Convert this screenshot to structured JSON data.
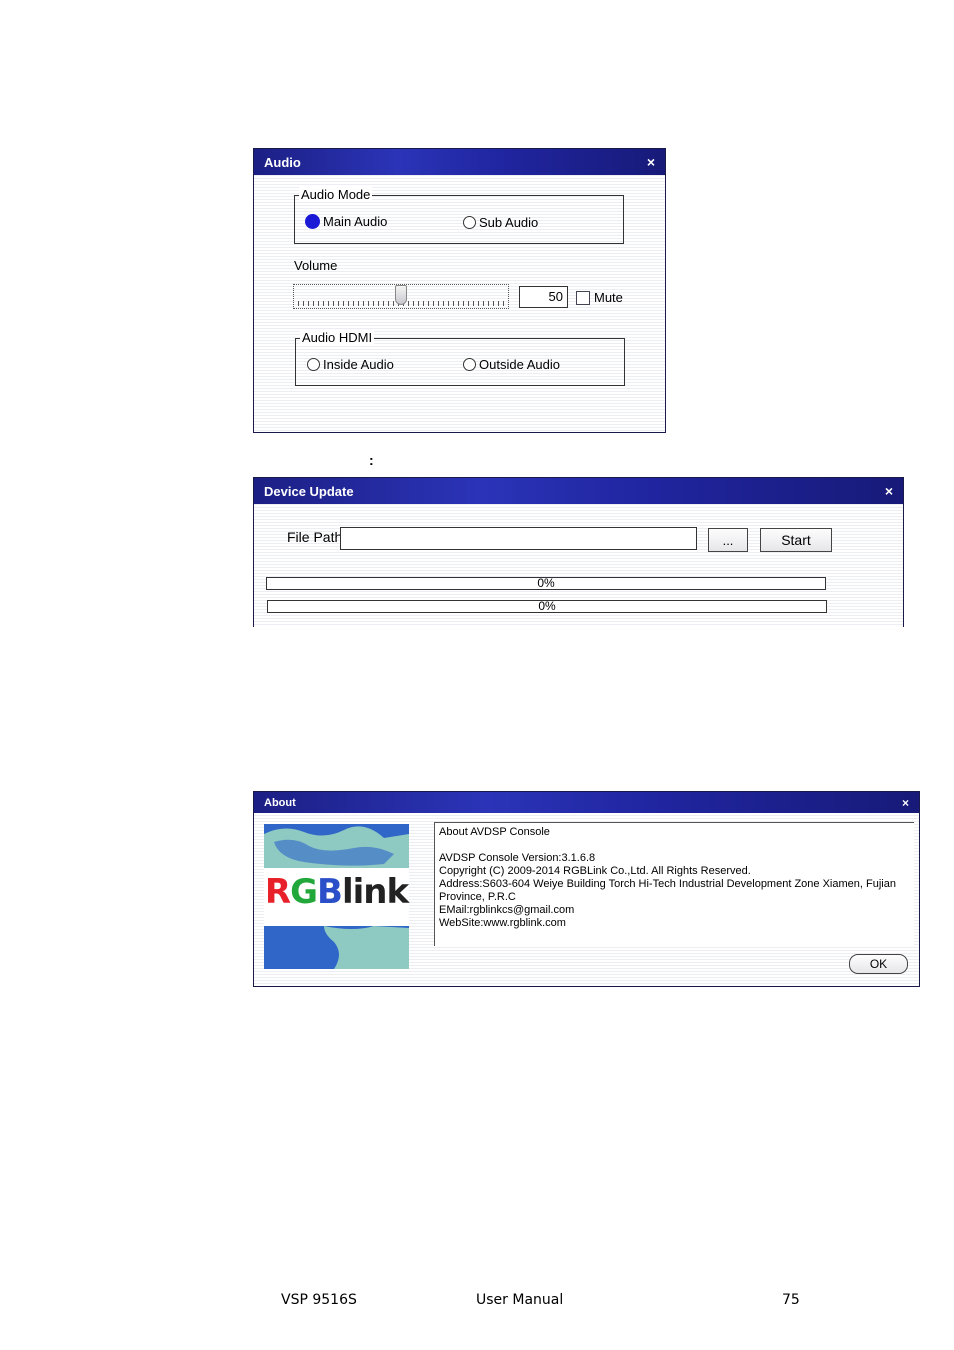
{
  "audio_dialog": {
    "title": "Audio",
    "close": "×",
    "audio_mode": {
      "label": "Audio Mode",
      "options": [
        "Main Audio",
        "Sub Audio"
      ],
      "selected": "Main Audio"
    },
    "volume": {
      "label": "Volume",
      "value": "50",
      "level_percent": 50,
      "mute_label": "Mute",
      "mute_checked": false
    },
    "audio_hdmi": {
      "label": "Audio HDMI",
      "options": [
        "Inside Audio",
        "Outside Audio"
      ],
      "selected": ""
    }
  },
  "separator_text": ":",
  "device_update_dialog": {
    "title": "Device Update",
    "close": "×",
    "file_path_label": "File Path",
    "file_path_value": "",
    "browse_label": "...",
    "start_label": "Start",
    "progress": [
      {
        "text": "0%",
        "percent": 0
      },
      {
        "text": "0%",
        "percent": 0
      }
    ]
  },
  "about_dialog": {
    "title": "About",
    "close": "×",
    "logo_text": "RGBlink",
    "lines": [
      "About AVDSP Console",
      "",
      "AVDSP Console  Version:3.1.6.8",
      "Copyright (C) 2009-2014 RGBLink Co.,Ltd. All Rights Reserved.",
      "Address:S603-604 Weiye Building Torch Hi-Tech Industrial Development Zone Xiamen, Fujian",
      "Province, P.R.C",
      "EMail:rgblinkcs@gmail.com",
      "WebSite:www.rgblink.com"
    ],
    "ok_label": "OK"
  },
  "footer": {
    "product": "VSP 9516S",
    "doc": "User Manual",
    "page": "75"
  },
  "colors": {
    "title_bar": "#2025a0",
    "radio_selected": "#1a1ad6",
    "logo_red": "#e8202a",
    "logo_green": "#22a83a",
    "logo_blue": "#2a4fc8"
  }
}
